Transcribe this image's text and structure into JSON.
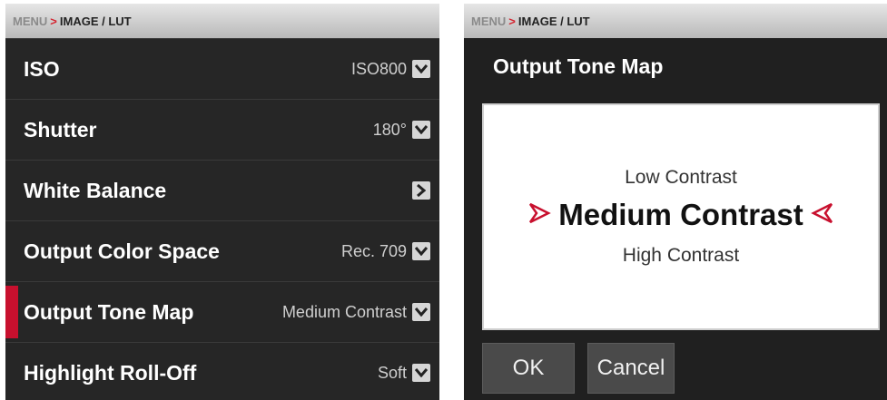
{
  "left": {
    "breadcrumb": {
      "menu": "MENU",
      "separator": ">",
      "current": "IMAGE / LUT"
    },
    "items": [
      {
        "label": "ISO",
        "value": "ISO800",
        "control": "dropdown"
      },
      {
        "label": "Shutter",
        "value": "180°",
        "control": "dropdown"
      },
      {
        "label": "White Balance",
        "value": "",
        "control": "submenu"
      },
      {
        "label": "Output Color Space",
        "value": "Rec. 709",
        "control": "dropdown"
      },
      {
        "label": "Output Tone Map",
        "value": "Medium Contrast",
        "control": "dropdown",
        "selected": true
      },
      {
        "label": "Highlight Roll-Off",
        "value": "Soft",
        "control": "dropdown"
      }
    ]
  },
  "right": {
    "breadcrumb": {
      "menu": "MENU",
      "separator": ">",
      "current": "IMAGE / LUT"
    },
    "title": "Output Tone Map",
    "options": {
      "above": "Low Contrast",
      "current": "Medium Contrast",
      "below": "High Contrast"
    },
    "buttons": {
      "ok": "OK",
      "cancel": "Cancel"
    }
  },
  "colors": {
    "accent": "#c8102e",
    "panel": "#262626",
    "dialog_bg": "#202020"
  },
  "icons": {
    "dropdown": "chevron-down-icon",
    "submenu": "chevron-right-icon",
    "selector_left": "arrow-right-marker-icon",
    "selector_right": "arrow-left-marker-icon"
  }
}
